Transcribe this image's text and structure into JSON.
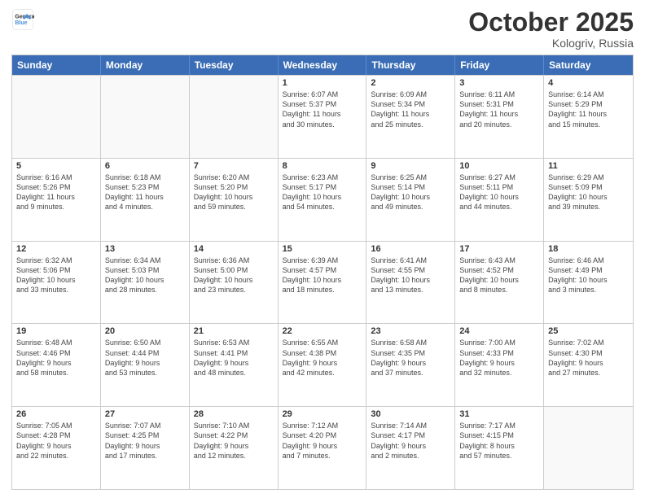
{
  "header": {
    "logo_line1": "General",
    "logo_line2": "Blue",
    "month": "October 2025",
    "location": "Kologriv, Russia"
  },
  "days_of_week": [
    "Sunday",
    "Monday",
    "Tuesday",
    "Wednesday",
    "Thursday",
    "Friday",
    "Saturday"
  ],
  "weeks": [
    [
      {
        "day": "",
        "text": ""
      },
      {
        "day": "",
        "text": ""
      },
      {
        "day": "",
        "text": ""
      },
      {
        "day": "1",
        "text": "Sunrise: 6:07 AM\nSunset: 5:37 PM\nDaylight: 11 hours\nand 30 minutes."
      },
      {
        "day": "2",
        "text": "Sunrise: 6:09 AM\nSunset: 5:34 PM\nDaylight: 11 hours\nand 25 minutes."
      },
      {
        "day": "3",
        "text": "Sunrise: 6:11 AM\nSunset: 5:31 PM\nDaylight: 11 hours\nand 20 minutes."
      },
      {
        "day": "4",
        "text": "Sunrise: 6:14 AM\nSunset: 5:29 PM\nDaylight: 11 hours\nand 15 minutes."
      }
    ],
    [
      {
        "day": "5",
        "text": "Sunrise: 6:16 AM\nSunset: 5:26 PM\nDaylight: 11 hours\nand 9 minutes."
      },
      {
        "day": "6",
        "text": "Sunrise: 6:18 AM\nSunset: 5:23 PM\nDaylight: 11 hours\nand 4 minutes."
      },
      {
        "day": "7",
        "text": "Sunrise: 6:20 AM\nSunset: 5:20 PM\nDaylight: 10 hours\nand 59 minutes."
      },
      {
        "day": "8",
        "text": "Sunrise: 6:23 AM\nSunset: 5:17 PM\nDaylight: 10 hours\nand 54 minutes."
      },
      {
        "day": "9",
        "text": "Sunrise: 6:25 AM\nSunset: 5:14 PM\nDaylight: 10 hours\nand 49 minutes."
      },
      {
        "day": "10",
        "text": "Sunrise: 6:27 AM\nSunset: 5:11 PM\nDaylight: 10 hours\nand 44 minutes."
      },
      {
        "day": "11",
        "text": "Sunrise: 6:29 AM\nSunset: 5:09 PM\nDaylight: 10 hours\nand 39 minutes."
      }
    ],
    [
      {
        "day": "12",
        "text": "Sunrise: 6:32 AM\nSunset: 5:06 PM\nDaylight: 10 hours\nand 33 minutes."
      },
      {
        "day": "13",
        "text": "Sunrise: 6:34 AM\nSunset: 5:03 PM\nDaylight: 10 hours\nand 28 minutes."
      },
      {
        "day": "14",
        "text": "Sunrise: 6:36 AM\nSunset: 5:00 PM\nDaylight: 10 hours\nand 23 minutes."
      },
      {
        "day": "15",
        "text": "Sunrise: 6:39 AM\nSunset: 4:57 PM\nDaylight: 10 hours\nand 18 minutes."
      },
      {
        "day": "16",
        "text": "Sunrise: 6:41 AM\nSunset: 4:55 PM\nDaylight: 10 hours\nand 13 minutes."
      },
      {
        "day": "17",
        "text": "Sunrise: 6:43 AM\nSunset: 4:52 PM\nDaylight: 10 hours\nand 8 minutes."
      },
      {
        "day": "18",
        "text": "Sunrise: 6:46 AM\nSunset: 4:49 PM\nDaylight: 10 hours\nand 3 minutes."
      }
    ],
    [
      {
        "day": "19",
        "text": "Sunrise: 6:48 AM\nSunset: 4:46 PM\nDaylight: 9 hours\nand 58 minutes."
      },
      {
        "day": "20",
        "text": "Sunrise: 6:50 AM\nSunset: 4:44 PM\nDaylight: 9 hours\nand 53 minutes."
      },
      {
        "day": "21",
        "text": "Sunrise: 6:53 AM\nSunset: 4:41 PM\nDaylight: 9 hours\nand 48 minutes."
      },
      {
        "day": "22",
        "text": "Sunrise: 6:55 AM\nSunset: 4:38 PM\nDaylight: 9 hours\nand 42 minutes."
      },
      {
        "day": "23",
        "text": "Sunrise: 6:58 AM\nSunset: 4:35 PM\nDaylight: 9 hours\nand 37 minutes."
      },
      {
        "day": "24",
        "text": "Sunrise: 7:00 AM\nSunset: 4:33 PM\nDaylight: 9 hours\nand 32 minutes."
      },
      {
        "day": "25",
        "text": "Sunrise: 7:02 AM\nSunset: 4:30 PM\nDaylight: 9 hours\nand 27 minutes."
      }
    ],
    [
      {
        "day": "26",
        "text": "Sunrise: 7:05 AM\nSunset: 4:28 PM\nDaylight: 9 hours\nand 22 minutes."
      },
      {
        "day": "27",
        "text": "Sunrise: 7:07 AM\nSunset: 4:25 PM\nDaylight: 9 hours\nand 17 minutes."
      },
      {
        "day": "28",
        "text": "Sunrise: 7:10 AM\nSunset: 4:22 PM\nDaylight: 9 hours\nand 12 minutes."
      },
      {
        "day": "29",
        "text": "Sunrise: 7:12 AM\nSunset: 4:20 PM\nDaylight: 9 hours\nand 7 minutes."
      },
      {
        "day": "30",
        "text": "Sunrise: 7:14 AM\nSunset: 4:17 PM\nDaylight: 9 hours\nand 2 minutes."
      },
      {
        "day": "31",
        "text": "Sunrise: 7:17 AM\nSunset: 4:15 PM\nDaylight: 8 hours\nand 57 minutes."
      },
      {
        "day": "",
        "text": ""
      }
    ]
  ]
}
